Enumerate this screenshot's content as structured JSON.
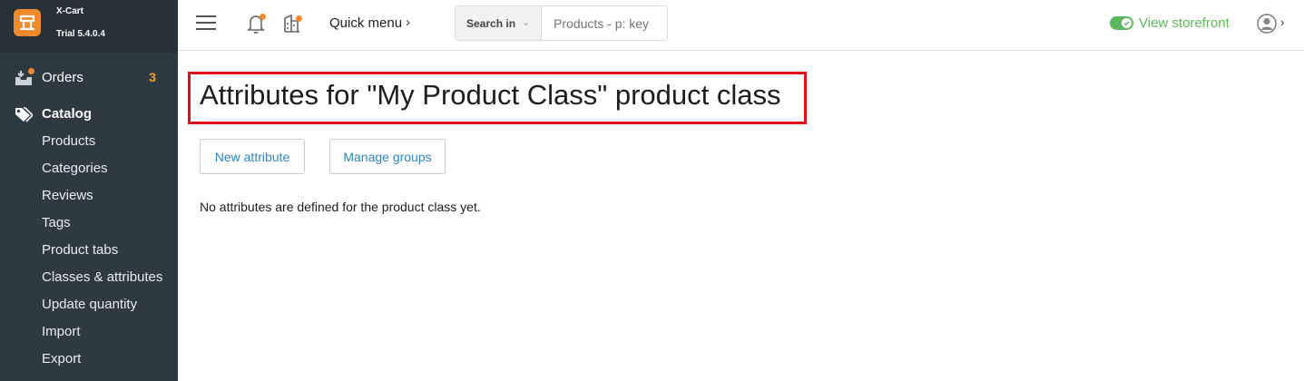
{
  "brand": {
    "name": "X-Cart",
    "version": "Trial 5.4.0.4"
  },
  "sidebar": {
    "orders": {
      "label": "Orders",
      "count": "3"
    },
    "catalog": {
      "label": "Catalog",
      "items": [
        {
          "label": "Products"
        },
        {
          "label": "Categories"
        },
        {
          "label": "Reviews"
        },
        {
          "label": "Tags"
        },
        {
          "label": "Product tabs"
        },
        {
          "label": "Classes & attributes"
        },
        {
          "label": "Update quantity"
        },
        {
          "label": "Import"
        },
        {
          "label": "Export"
        }
      ]
    }
  },
  "header": {
    "quick_menu": "Quick menu",
    "search": {
      "scope_label": "Search in",
      "placeholder": "Products - p: key"
    },
    "storefront": "View storefront"
  },
  "main": {
    "title": "Attributes for \"My Product Class\" product class",
    "buttons": {
      "new_attribute": "New attribute",
      "manage_groups": "Manage groups"
    },
    "empty_message": "No attributes are defined for the product class yet."
  },
  "colors": {
    "accent": "#f08a2c",
    "sidebar": "#2e3a42",
    "link": "#2b86c5",
    "success": "#5cb85c",
    "highlight": "#e20d17"
  }
}
